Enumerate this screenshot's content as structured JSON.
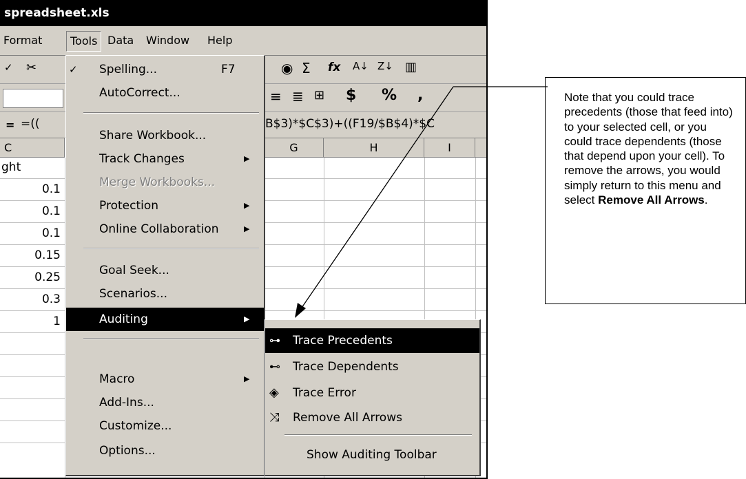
{
  "window": {
    "title": "spreadsheet.xls"
  },
  "menubar": [
    "Format",
    "Tools",
    "Data",
    "Window",
    "Help"
  ],
  "formula": {
    "left": "=((",
    "right": "B$3)*$C$3)+((F19/$B$4)*$C"
  },
  "grid": {
    "columns": [
      "C",
      "G",
      "H",
      "I"
    ],
    "cells": [
      "ght",
      "0.1",
      "0.1",
      "0.1",
      "0.15",
      "0.25",
      "0.3",
      "1"
    ]
  },
  "tools_menu": {
    "items": [
      {
        "label": "Spelling...",
        "shortcut": "F7"
      },
      {
        "label": "AutoCorrect..."
      },
      {
        "label": "Share Workbook..."
      },
      {
        "label": "Track Changes",
        "submenu": true
      },
      {
        "label": "Merge Workbooks...",
        "disabled": true
      },
      {
        "label": "Protection",
        "submenu": true
      },
      {
        "label": "Online Collaboration",
        "submenu": true
      },
      {
        "label": "Goal Seek..."
      },
      {
        "label": "Scenarios..."
      },
      {
        "label": "Auditing",
        "submenu": true,
        "highlighted": true
      },
      {
        "label": "Macro",
        "submenu": true
      },
      {
        "label": "Add-Ins..."
      },
      {
        "label": "Customize..."
      },
      {
        "label": "Options..."
      }
    ]
  },
  "auditing_submenu": {
    "items": [
      {
        "label": "Trace Precedents",
        "highlighted": true
      },
      {
        "label": "Trace Dependents"
      },
      {
        "label": "Trace Error"
      },
      {
        "label": "Remove All Arrows"
      },
      {
        "label": "Show Auditing Toolbar"
      }
    ]
  },
  "note": {
    "text": "Note that you could trace precedents (those that feed into) to your selected cell, or you could trace dependents (those that depend upon your cell).  To remove the arrows, you would simply return to this menu and select ",
    "bold": "Remove All Arrows",
    "end": "."
  },
  "toolbar": {
    "row2_symbols": [
      "$",
      "%",
      ","
    ]
  },
  "colors": {
    "highlight": "#000000",
    "menu_bg": "#d4d0c8",
    "title_bg": "#000000"
  }
}
